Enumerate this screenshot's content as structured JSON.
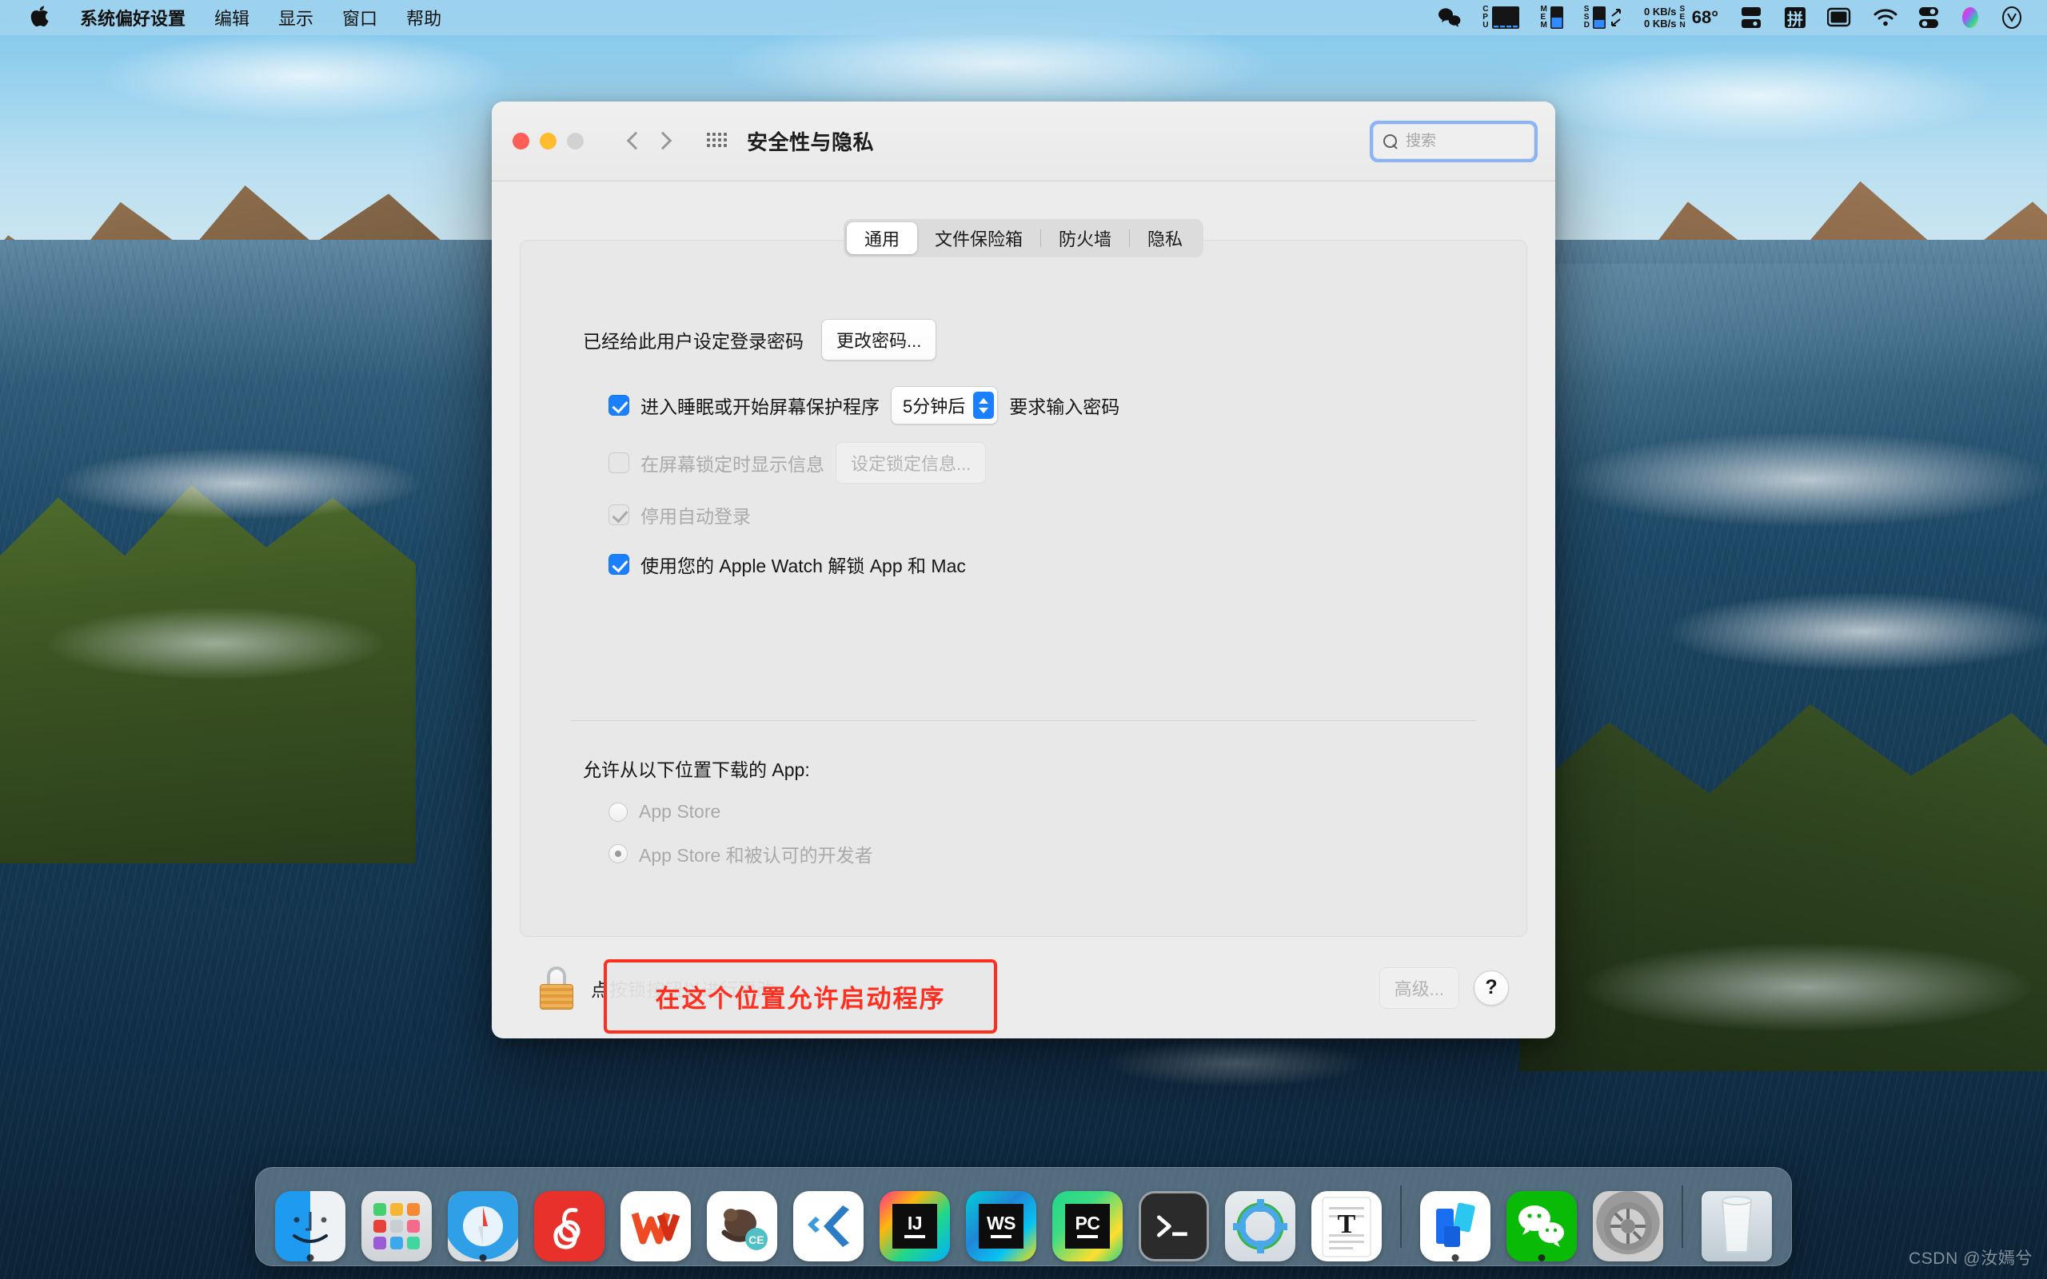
{
  "menubar": {
    "apple_icon": "apple-logo-icon",
    "items": [
      {
        "label": "系统偏好设置",
        "bold": true
      },
      {
        "label": "编辑",
        "bold": false
      },
      {
        "label": "显示",
        "bold": false
      },
      {
        "label": "窗口",
        "bold": false
      },
      {
        "label": "帮助",
        "bold": false
      }
    ],
    "status": {
      "wechat_icon": "wechat-icon",
      "cpu_label": "CPU",
      "mem_label": "MEM",
      "ssd_label": "SSD",
      "net_up": "0 KB/s",
      "net_down": "0 KB/s",
      "sen_label": "SEN",
      "temperature": "68°",
      "display_icon": "display-icon",
      "input_method": "拼",
      "screen_icon": "screen-mirroring-icon",
      "wifi_icon": "wifi-icon",
      "control_center_icon": "control-center-icon",
      "siri_icon": "siri-icon",
      "clock_icon": "clock-icon"
    }
  },
  "window": {
    "title": "安全性与隐私",
    "traffic_lights": [
      "close-button",
      "minimize-button",
      "zoom-button"
    ],
    "nav": {
      "back": "back-chevron-icon",
      "forward": "forward-chevron-icon",
      "grid": "show-all-grid-icon"
    },
    "search": {
      "placeholder": "搜索",
      "value": "",
      "icon": "search-icon",
      "focused": true
    }
  },
  "tabs": [
    {
      "label": "通用",
      "active": true
    },
    {
      "label": "文件保险箱",
      "active": false
    },
    {
      "label": "防火墙",
      "active": false
    },
    {
      "label": "隐私",
      "active": false
    }
  ],
  "general": {
    "password_status": "已经给此用户设定登录密码",
    "change_password_button": "更改密码...",
    "require_password": {
      "checked": true,
      "label_before": "进入睡眠或开始屏幕保护程序",
      "delay_value": "5分钟后",
      "label_after": "要求输入密码"
    },
    "show_message": {
      "checked": false,
      "disabled": true,
      "label": "在屏幕锁定时显示信息",
      "button": "设定锁定信息..."
    },
    "disable_auto_login": {
      "checked": true,
      "disabled": true,
      "label": "停用自动登录"
    },
    "apple_watch_unlock": {
      "checked": true,
      "disabled": false,
      "label": "使用您的 Apple Watch 解锁 App 和 Mac"
    }
  },
  "download_section": {
    "title": "允许从以下位置下载的 App:",
    "options": [
      {
        "label": "App Store",
        "selected": false,
        "disabled": true
      },
      {
        "label": "App Store 和被认可的开发者",
        "selected": true,
        "disabled": true
      }
    ]
  },
  "annotation": {
    "text": "在这个位置允许启动程序",
    "color": "#ff2e1e"
  },
  "bottom_bar": {
    "lock_icon": "lock-closed-icon",
    "lock_message": "点按锁按钮以进行更改。",
    "advanced_button": "高级...",
    "advanced_disabled": true,
    "help_button": "?"
  },
  "dock": {
    "items": [
      {
        "name": "finder",
        "label": "访达",
        "running": true
      },
      {
        "name": "launchpad",
        "label": "启动台",
        "running": false
      },
      {
        "name": "safari",
        "label": "Safari 浏览器",
        "running": true
      },
      {
        "name": "netease-music",
        "label": "网易云音乐",
        "running": false
      },
      {
        "name": "wps-office",
        "label": "WPS Office",
        "running": false
      },
      {
        "name": "navicat",
        "label": "Navicat",
        "running": false
      },
      {
        "name": "vscode",
        "label": "Visual Studio Code",
        "running": false
      },
      {
        "name": "intellij-idea",
        "label": "IntelliJ IDEA",
        "running": false,
        "badge": "IJ"
      },
      {
        "name": "webstorm",
        "label": "WebStorm",
        "running": false,
        "badge": "WS"
      },
      {
        "name": "pycharm",
        "label": "PyCharm",
        "running": false,
        "badge": "PC"
      },
      {
        "name": "terminal",
        "label": "终端",
        "running": false
      },
      {
        "name": "xcode",
        "label": "Xcode",
        "running": false
      },
      {
        "name": "textedit",
        "label": "文本编辑",
        "running": false
      },
      {
        "name": "separator-1",
        "label": "",
        "running": false
      },
      {
        "name": "lark",
        "label": "飞书",
        "running": true
      },
      {
        "name": "wechat",
        "label": "微信",
        "running": true
      },
      {
        "name": "system-preferences",
        "label": "系统偏好设置",
        "running": false
      },
      {
        "name": "separator-2",
        "label": "",
        "running": false
      },
      {
        "name": "trash",
        "label": "废纸篓",
        "running": false
      }
    ]
  },
  "watermark": "CSDN @汝嫣兮",
  "colors": {
    "accent_blue": "#1a80ff",
    "focus_ring": "#8ab4f8",
    "annotation_red": "#ff2e1e",
    "menubar_bg": "#a8d7f0",
    "window_bg": "#ececec",
    "panel_bg": "#e8e8e8"
  }
}
